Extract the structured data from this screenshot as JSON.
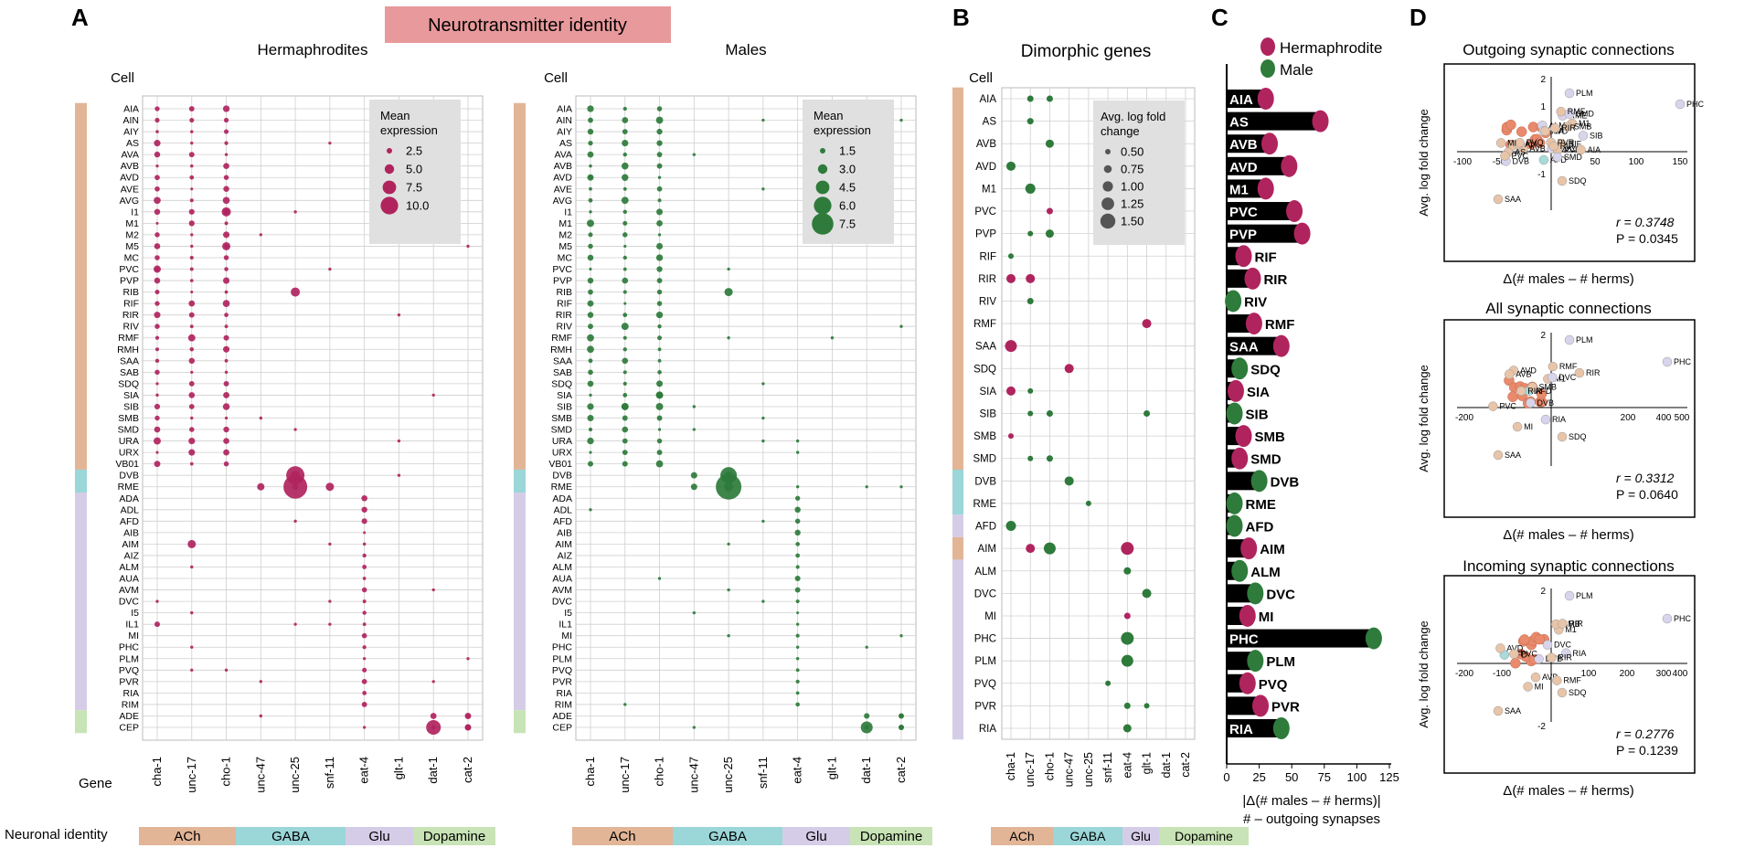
{
  "panel_letters": [
    "A",
    "B",
    "C",
    "D"
  ],
  "banner": {
    "title": "Neurotransmitter identity",
    "color": "#e8999b"
  },
  "colors": {
    "herm": "#b0245e",
    "male": "#2e7b3b",
    "ach": "#e2b597",
    "gaba": "#9bd6d8",
    "glu": "#d5cde7",
    "dopa": "#c8e3b5"
  },
  "identity_legend": {
    "title": "Neuronal identity",
    "groups": [
      "ACh",
      "GABA",
      "Glu",
      "Dopamine"
    ]
  },
  "A": {
    "cell_label": "Cell",
    "gene_label": "Gene",
    "genes": [
      "cha-1",
      "unc-17",
      "cho-1",
      "unc-47",
      "unc-25",
      "snf-11",
      "eat-4",
      "glt-1",
      "dat-1",
      "cat-2"
    ],
    "cells": [
      "AIA",
      "AIN",
      "AIY",
      "AS",
      "AVA",
      "AVB",
      "AVD",
      "AVE",
      "AVG",
      "I1",
      "M1",
      "M2",
      "M5",
      "MC",
      "PVC",
      "PVP",
      "RIB",
      "RIF",
      "RIR",
      "RIV",
      "RMF",
      "RMH",
      "SAA",
      "SAB",
      "SDQ",
      "SIA",
      "SIB",
      "SMB",
      "SMD",
      "URA",
      "URX",
      "VB01",
      "DVB",
      "RME",
      "ADA",
      "ADL",
      "AFD",
      "AIB",
      "AIM",
      "AIZ",
      "ALM",
      "AUA",
      "AVM",
      "DVC",
      "I5",
      "IL1",
      "MI",
      "PHC",
      "PLM",
      "PVQ",
      "PVR",
      "RIA",
      "RIM",
      "ADE",
      "CEP"
    ],
    "herm": {
      "title": "Hermaphrodites",
      "legend_title": [
        "Mean",
        "expression"
      ],
      "legend_values": [
        "2.5",
        "5.0",
        "7.5",
        "10.0"
      ]
    },
    "male": {
      "title": "Males",
      "legend_title": [
        "Mean",
        "expression"
      ],
      "legend_values": [
        "1.5",
        "3.0",
        "4.5",
        "6.0",
        "7.5"
      ]
    }
  },
  "B": {
    "title": "Dimorphic genes",
    "cell_label": "Cell",
    "cells": [
      "AIA",
      "AS",
      "AVB",
      "AVD",
      "M1",
      "PVC",
      "PVP",
      "RIF",
      "RIR",
      "RIV",
      "RMF",
      "SAA",
      "SDQ",
      "SIA",
      "SIB",
      "SMB",
      "SMD",
      "DVB",
      "RME",
      "AFD",
      "AIM",
      "ALM",
      "DVC",
      "MI",
      "PHC",
      "PLM",
      "PVQ",
      "PVR",
      "RIA"
    ],
    "genes": [
      "cha-1",
      "unc-17",
      "cho-1",
      "unc-47",
      "unc-25",
      "snf-11",
      "eat-4",
      "glt-1",
      "dat-1",
      "cat-2"
    ],
    "legend_title": [
      "Avg. log fold",
      "change"
    ],
    "legend_values": [
      "0.50",
      "0.75",
      "1.00",
      "1.25",
      "1.50"
    ]
  },
  "C": {
    "legend": [
      "Hermaphrodite",
      "Male"
    ],
    "xlabel": [
      "|Δ(# males – # herms)|",
      "# – outgoing synapses"
    ],
    "ticks": [
      "0",
      "25",
      "50",
      "75",
      "100",
      "125"
    ],
    "bars": [
      {
        "cell": "AIA",
        "value": 30,
        "sex": "herm"
      },
      {
        "cell": "AS",
        "value": 72,
        "sex": "herm"
      },
      {
        "cell": "AVB",
        "value": 33,
        "sex": "herm"
      },
      {
        "cell": "AVD",
        "value": 48,
        "sex": "herm"
      },
      {
        "cell": "M1",
        "value": 30,
        "sex": "herm"
      },
      {
        "cell": "PVC",
        "value": 52,
        "sex": "herm"
      },
      {
        "cell": "PVP",
        "value": 58,
        "sex": "herm"
      },
      {
        "cell": "RIF",
        "value": 13,
        "sex": "herm"
      },
      {
        "cell": "RIR",
        "value": 20,
        "sex": "herm"
      },
      {
        "cell": "RIV",
        "value": 5,
        "sex": "male"
      },
      {
        "cell": "RMF",
        "value": 21,
        "sex": "herm"
      },
      {
        "cell": "SAA",
        "value": 42,
        "sex": "herm"
      },
      {
        "cell": "SDQ",
        "value": 10,
        "sex": "male"
      },
      {
        "cell": "SIA",
        "value": 7,
        "sex": "herm"
      },
      {
        "cell": "SIB",
        "value": 6,
        "sex": "male"
      },
      {
        "cell": "SMB",
        "value": 13,
        "sex": "herm"
      },
      {
        "cell": "SMD",
        "value": 10,
        "sex": "herm"
      },
      {
        "cell": "DVB",
        "value": 25,
        "sex": "male"
      },
      {
        "cell": "RME",
        "value": 6,
        "sex": "male"
      },
      {
        "cell": "AFD",
        "value": 6,
        "sex": "male"
      },
      {
        "cell": "AIM",
        "value": 17,
        "sex": "herm"
      },
      {
        "cell": "ALM",
        "value": 10,
        "sex": "male"
      },
      {
        "cell": "DVC",
        "value": 22,
        "sex": "male"
      },
      {
        "cell": "MI",
        "value": 16,
        "sex": "herm"
      },
      {
        "cell": "PHC",
        "value": 113,
        "sex": "male"
      },
      {
        "cell": "PLM",
        "value": 22,
        "sex": "male"
      },
      {
        "cell": "PVQ",
        "value": 16,
        "sex": "herm"
      },
      {
        "cell": "PVR",
        "value": 26,
        "sex": "herm"
      },
      {
        "cell": "RIA",
        "value": 42,
        "sex": "male"
      }
    ]
  },
  "D": {
    "ylabel": "Avg. log fold change",
    "xlabel": "Δ(# males – # herms)",
    "panels": [
      {
        "title": "Outgoing synaptic connections",
        "xticks": [
          "-100",
          "-50",
          "50",
          "100",
          "150"
        ],
        "yticks": [
          "2",
          "1",
          "-1"
        ],
        "r": "r = 0.3748",
        "p": "P = 0.0345",
        "labels": [
          "PLM",
          "PHC",
          "AFD",
          "DVB",
          "DVC",
          "ALM",
          "RIA",
          "RME",
          "SIB",
          "RIF",
          "SMD",
          "RIV",
          "M1",
          "AVD",
          "AVB",
          "AS",
          "PVP",
          "PVR",
          "AIA",
          "PVQ",
          "SMB",
          "PVC",
          "RIR",
          "RIR",
          "RMF",
          "MI",
          "SDQ",
          "SAA",
          "AIA",
          "SMD"
        ]
      },
      {
        "title": "All synaptic connections",
        "xticks": [
          "-200",
          "200",
          "400",
          "500"
        ],
        "yticks": [
          "2"
        ],
        "r": "r = 0.3312",
        "p": "P = 0.0640",
        "labels": [
          "PLM",
          "PHC",
          "AFD",
          "AVD",
          "M1",
          "DVB",
          "AVB",
          "DVC",
          "RIA",
          "SMB",
          "PVC",
          "RIR",
          "RIR",
          "MI",
          "RMF",
          "SDQ",
          "SAA"
        ]
      },
      {
        "title": "Incoming synaptic connections",
        "xticks": [
          "-200",
          "-100",
          "100",
          "200",
          "300",
          "400"
        ],
        "yticks": [
          "2",
          "-2"
        ],
        "r": "r = 0.2776",
        "p": "P = 0.1239",
        "labels": [
          "PLM",
          "PHC",
          "AFD",
          "AVD",
          "AVB",
          "DVB",
          "M1",
          "DVC",
          "RIA",
          "PVC",
          "SMB",
          "RIR",
          "MI",
          "RIR",
          "RMF",
          "SDQ",
          "SAA"
        ]
      }
    ]
  }
}
